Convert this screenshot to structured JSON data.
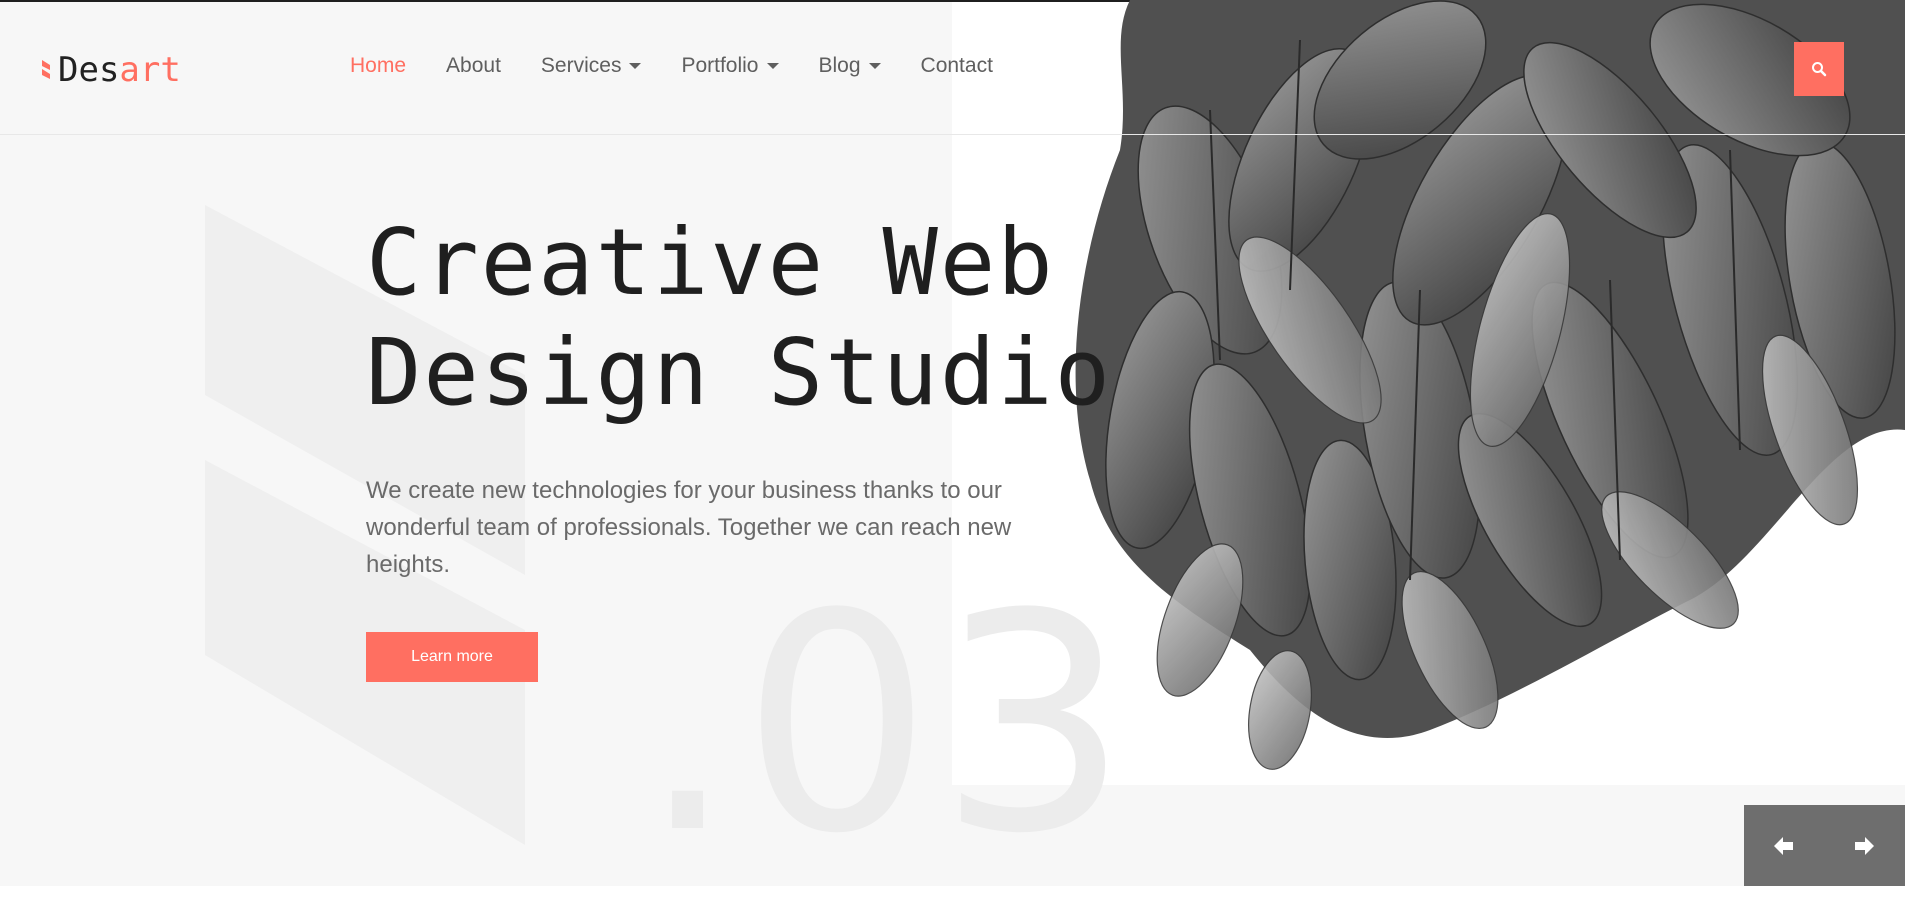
{
  "brand": {
    "logo_part1": "Des",
    "logo_part2": "art",
    "accent_color": "#ff6f61",
    "logo_mark_icon": "logo-chevron-icon"
  },
  "nav": {
    "items": [
      {
        "label": "Home",
        "active": true,
        "dropdown": false
      },
      {
        "label": "About",
        "active": false,
        "dropdown": false
      },
      {
        "label": "Services",
        "active": false,
        "dropdown": true
      },
      {
        "label": "Portfolio",
        "active": false,
        "dropdown": true
      },
      {
        "label": "Blog",
        "active": false,
        "dropdown": true
      },
      {
        "label": "Contact",
        "active": false,
        "dropdown": false
      }
    ],
    "search_icon": "search-icon"
  },
  "hero": {
    "title_line1": "Creative Web",
    "title_line2": "Design Studio",
    "description": "We create new technologies for your business thanks to our wonderful team of professionals. Together we can reach new heights.",
    "cta_label": "Learn more",
    "slide_number": ".03",
    "image": "grayscale-leaves-photo"
  },
  "slider": {
    "prev_icon": "arrow-left-icon",
    "next_icon": "arrow-right-icon"
  }
}
